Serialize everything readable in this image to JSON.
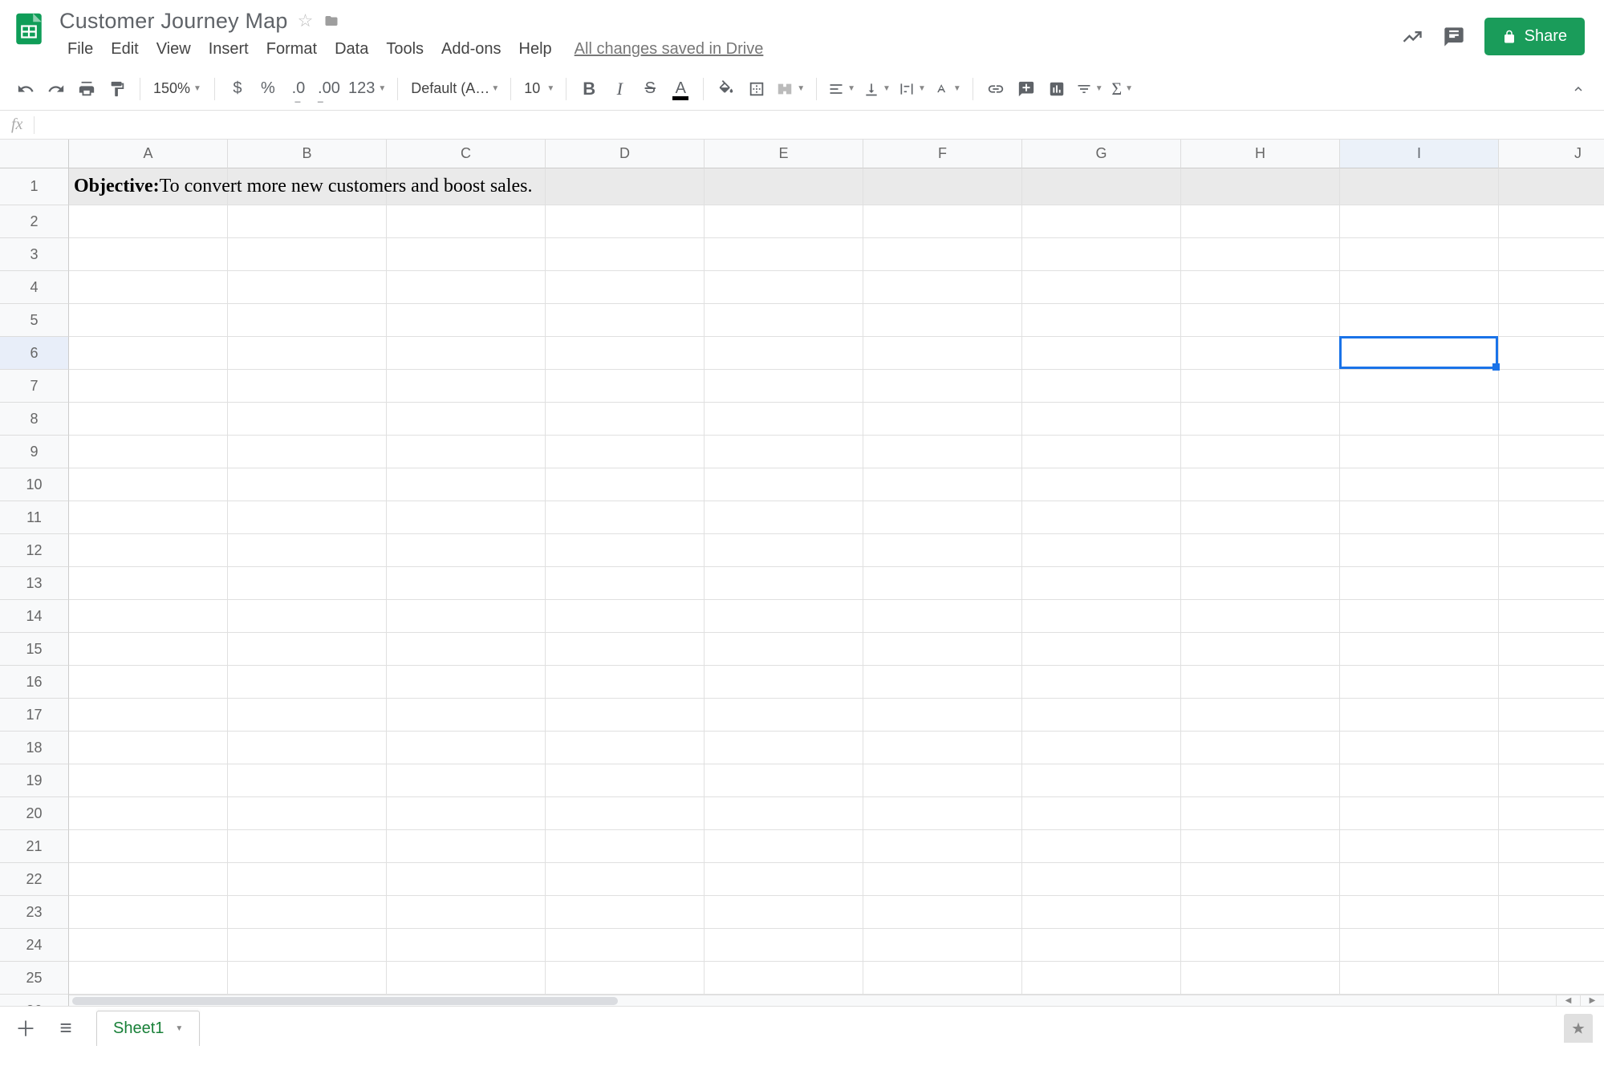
{
  "header": {
    "doc_title": "Customer Journey Map",
    "menus": [
      "File",
      "Edit",
      "View",
      "Insert",
      "Format",
      "Data",
      "Tools",
      "Add-ons",
      "Help"
    ],
    "save_status": "All changes saved in Drive",
    "share_label": "Share"
  },
  "toolbar": {
    "zoom": "150%",
    "currency": "$",
    "percent": "%",
    "dec_less": ".0",
    "dec_more": ".00",
    "num_fmt": "123",
    "font": "Default (Ari...",
    "font_size": "10"
  },
  "formula_bar": {
    "label": "fx",
    "value": ""
  },
  "sheet": {
    "columns": [
      "A",
      "B",
      "C",
      "D",
      "E",
      "F",
      "G",
      "H",
      "I",
      "J"
    ],
    "rows": 26,
    "row1": {
      "bold_prefix": "Objective:",
      "text_rest": " To convert more new customers and boost sales."
    },
    "selected": {
      "col": "I",
      "row": 6
    }
  },
  "footer": {
    "tabs": [
      {
        "name": "Sheet1"
      }
    ]
  }
}
